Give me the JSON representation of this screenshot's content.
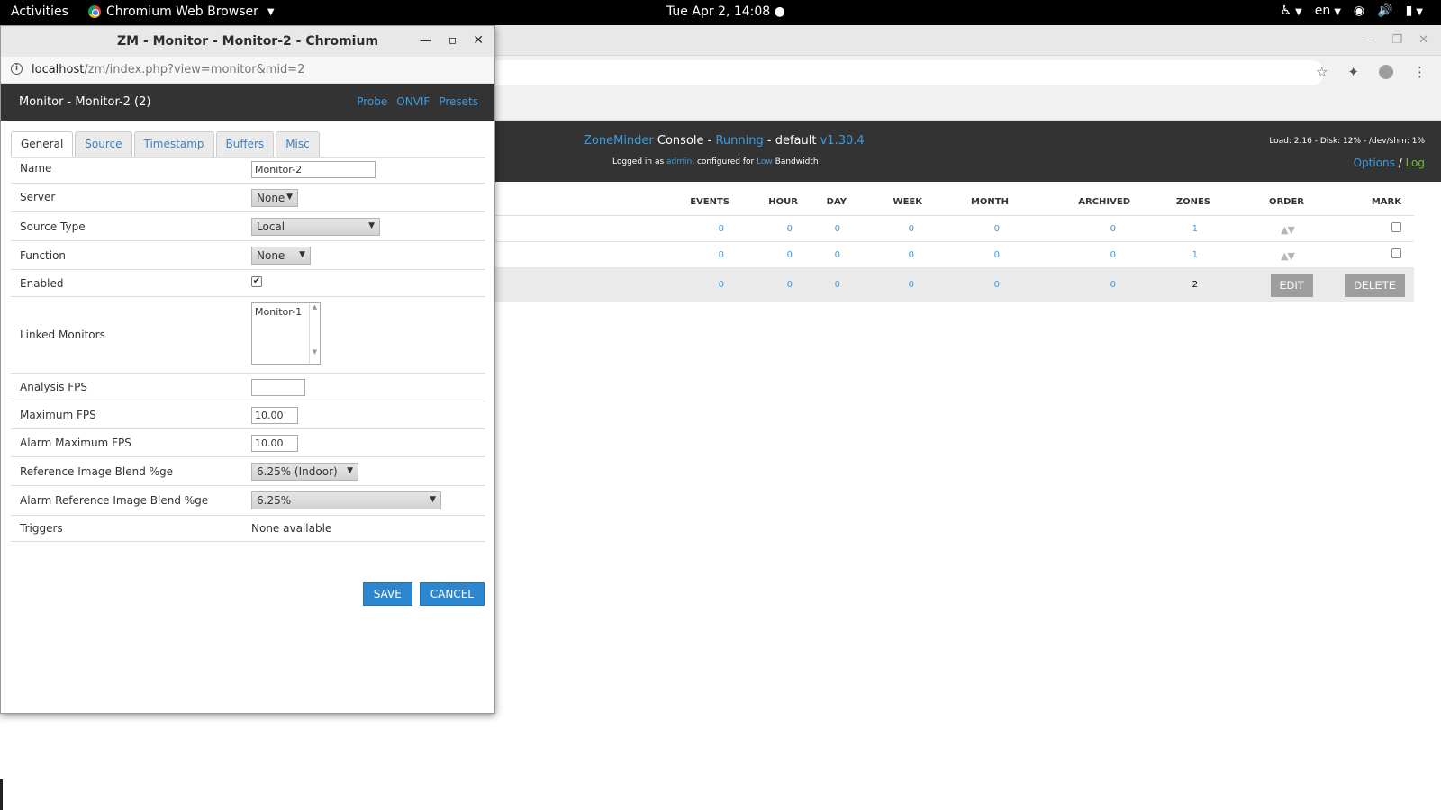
{
  "topbar": {
    "activities": "Activities",
    "app_name": "Chromium Web Browser",
    "clock": "Tue Apr  2, 14:08 ●",
    "lang": "en"
  },
  "background_window": {
    "header": {
      "brand": "ZoneMinder",
      "console": " Console - ",
      "status": "Running",
      "state": " - default ",
      "version": "v1.30.4",
      "logged_prefix": "Logged in as ",
      "user": "admin",
      "configured": ", configured for ",
      "bandwidth": "Low",
      "bandwidth_suffix": " Bandwidth",
      "load": "Load: 2.16 - Disk: 12% - /dev/shm: 1%",
      "options": "Options",
      "sep": " / ",
      "log": "Log"
    },
    "table": {
      "columns": [
        "EVENTS",
        "HOUR",
        "DAY",
        "WEEK",
        "MONTH",
        "ARCHIVED",
        "ZONES",
        "ORDER",
        "MARK"
      ],
      "rows": [
        {
          "events": "0",
          "hour": "0",
          "day": "0",
          "week": "0",
          "month": "0",
          "archived": "0",
          "zones": "1"
        },
        {
          "events": "0",
          "hour": "0",
          "day": "0",
          "week": "0",
          "month": "0",
          "archived": "0",
          "zones": "1"
        }
      ],
      "totals": {
        "events": "0",
        "hour": "0",
        "day": "0",
        "week": "0",
        "month": "0",
        "archived": "0",
        "zones": "2"
      },
      "edit_label": "EDIT",
      "delete_label": "DELETE",
      "order_arrows": "▲▼"
    }
  },
  "popup": {
    "window_title": "ZM - Monitor - Monitor-2 - Chromium",
    "url_host": "localhost",
    "url_path": "/zm/index.php?view=monitor&mid=2",
    "header_title": "Monitor - Monitor-2 (2)",
    "header_links": [
      "Probe",
      "ONVIF",
      "Presets"
    ],
    "tabs": [
      "General",
      "Source",
      "Timestamp",
      "Buffers",
      "Misc"
    ],
    "fields": {
      "name_label": "Name",
      "name_value": "Monitor-2",
      "server_label": "Server",
      "server_value": "None",
      "source_type_label": "Source Type",
      "source_type_value": "Local",
      "function_label": "Function",
      "function_value": "None",
      "enabled_label": "Enabled",
      "linked_label": "Linked Monitors",
      "linked_option": "Monitor-1",
      "analysis_fps_label": "Analysis FPS",
      "analysis_fps_value": "",
      "max_fps_label": "Maximum FPS",
      "max_fps_value": "10.00",
      "alarm_max_fps_label": "Alarm Maximum FPS",
      "alarm_max_fps_value": "10.00",
      "ref_blend_label": "Reference Image Blend %ge",
      "ref_blend_value": "6.25% (Indoor)",
      "alarm_ref_blend_label": "Alarm Reference Image Blend %ge",
      "alarm_ref_blend_value": "6.25%",
      "triggers_label": "Triggers",
      "triggers_value": "None available"
    },
    "save_label": "SAVE",
    "cancel_label": "CANCEL"
  }
}
